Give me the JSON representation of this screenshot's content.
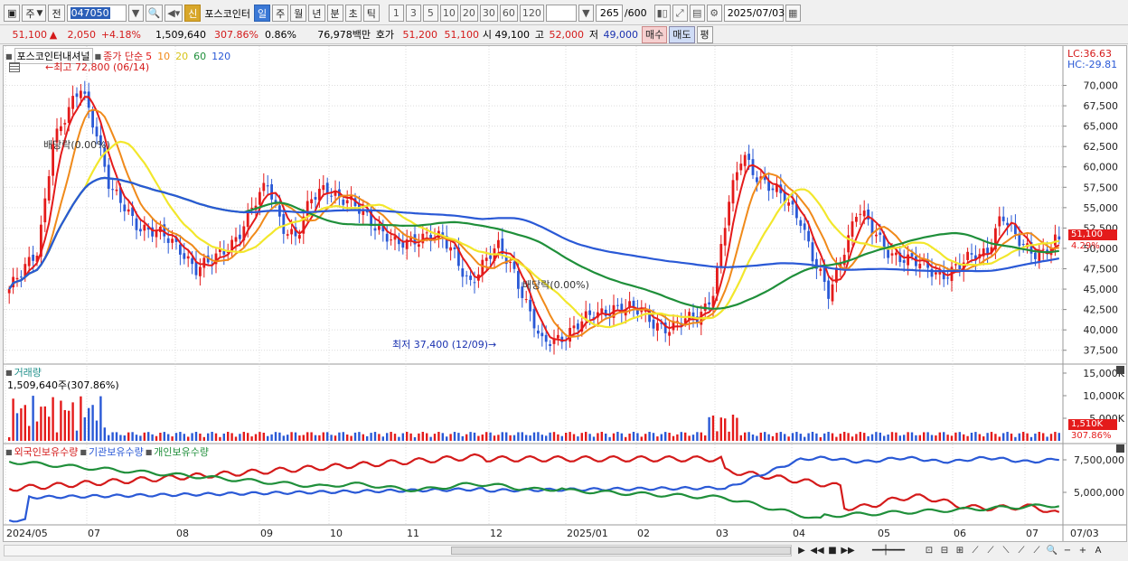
{
  "toolbar": {
    "market": "주",
    "type_btn": "전",
    "code": "047050",
    "stock_badge": "신",
    "stock_name": "포스코인터",
    "period_tabs": [
      "일",
      "주",
      "월",
      "년",
      "분",
      "초",
      "틱"
    ],
    "interval_buttons": [
      "1",
      "3",
      "5",
      "10",
      "20",
      "30",
      "60",
      "120"
    ],
    "count": "265",
    "count_total": "/600",
    "date": "2025/07/03"
  },
  "quote": {
    "price": "51,100",
    "change": "2,050",
    "change_pct": "+4.18%",
    "volume": "1,509,640",
    "volume_pct": "307.86%",
    "turnover_pct": "0.86%",
    "amount": "76,978백만",
    "quote_label": "호가",
    "ask": "51,200",
    "bid": "51,100",
    "open_label": "시",
    "open": "49,100",
    "high_label": "고",
    "high": "52,000",
    "low_label": "저",
    "low": "49,000",
    "buy_btn": "매수",
    "sell_btn": "매도",
    "eval_btn": "평"
  },
  "price_panel": {
    "stock_label": "포스코인터내셔널",
    "legend_prefix": "종가 단순",
    "ma_periods": [
      "5",
      "10",
      "20",
      "60",
      "120"
    ],
    "ma_colors": [
      "#e41b1b",
      "#f08a1a",
      "#f2e72c",
      "#1f8f3a",
      "#2a59d6"
    ],
    "lc": "LC:36.63",
    "hc": "HC:-29.81",
    "high_note": "최고 72,800 (06/14)",
    "low_note": "최저 37,400 (12/09)",
    "div_note1": "배당락(0.00%)",
    "div_note2": "배당락(0.00%)",
    "y_ticks": [
      "70,000",
      "67,500",
      "65,000",
      "62,500",
      "60,000",
      "57,500",
      "55,000",
      "52,500",
      "50,000",
      "47,500",
      "45,000",
      "42,500",
      "40,000",
      "37,500"
    ],
    "last_price_tag": "51,100",
    "last_pct_tag": "4.29%"
  },
  "volume_panel": {
    "title": "거래량",
    "value": "1,509,640주(307.86%)",
    "y_ticks": [
      "15,000K",
      "10,000K",
      "5,000K"
    ],
    "last_tag": "1,510K",
    "last_pct": "307.86%"
  },
  "holding_panel": {
    "series": [
      "외국인보유수량",
      "기관보유수량",
      "개인보유수량"
    ],
    "colors": [
      "#d41a1a",
      "#2a59d6",
      "#1f8f3a"
    ],
    "y_ticks": [
      "7,500,000",
      "5,000,000"
    ]
  },
  "x_axis": {
    "labels": [
      "2024/05",
      "07",
      "08",
      "09",
      "10",
      "11",
      "12",
      "2025/01",
      "02",
      "03",
      "04",
      "05",
      "06",
      "07"
    ],
    "right_label": "07/03"
  },
  "chart_data": {
    "type": "candlestick",
    "y_range": [
      36250,
      71500
    ],
    "price_series_approx": [
      45000,
      47000,
      50000,
      63000,
      66000,
      70000,
      65000,
      57000,
      55000,
      53000,
      52000,
      51000,
      50000,
      47500,
      48000,
      50000,
      52000,
      55000,
      58000,
      53000,
      51000,
      56000,
      58000,
      56000,
      55000,
      54000,
      52000,
      50000,
      51000,
      52000,
      51000,
      49000,
      46000,
      48000,
      50000,
      48000,
      43000,
      38000,
      39000,
      40000,
      41000,
      42000,
      43000,
      42500,
      42000,
      41000,
      40000,
      41000,
      42000,
      45000,
      55000,
      62000,
      59000,
      57000,
      56000,
      54000,
      48000,
      44000,
      50000,
      55000,
      52000,
      50000,
      49000,
      48000,
      47500,
      47000,
      47500,
      49000,
      50000,
      54000,
      51000,
      50000,
      49500,
      51100
    ],
    "high": 72800,
    "low": 37400,
    "last_close": 51100
  }
}
